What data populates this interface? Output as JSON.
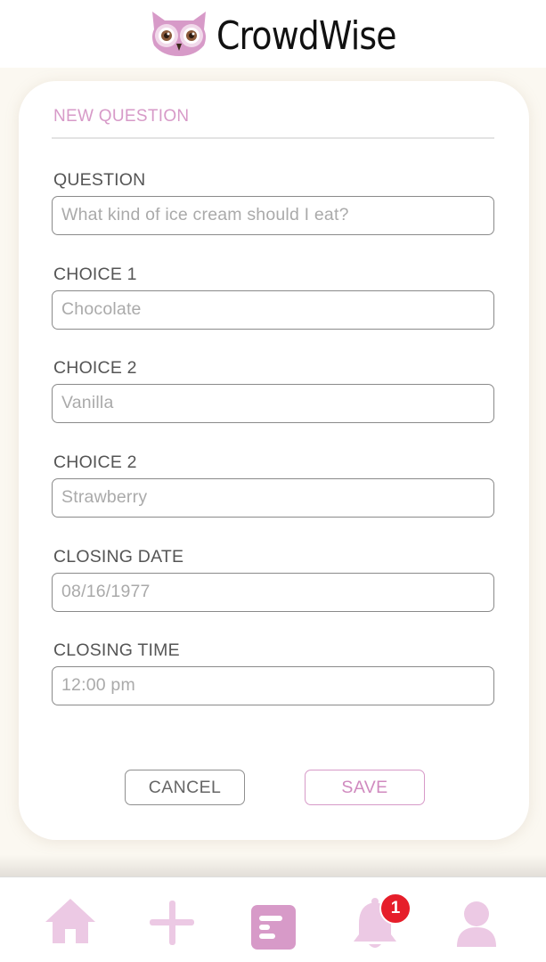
{
  "app": {
    "name": "CrowdWise"
  },
  "form": {
    "title": "NEW QUESTION",
    "fields": [
      {
        "label": "QUESTION",
        "placeholder": "What kind of ice cream should I eat?"
      },
      {
        "label": "CHOICE 1",
        "placeholder": "Chocolate"
      },
      {
        "label": "CHOICE 2",
        "placeholder": "Vanilla"
      },
      {
        "label": "CHOICE 2",
        "placeholder": "Strawberry"
      },
      {
        "label": "CLOSING DATE",
        "placeholder": "08/16/1977"
      },
      {
        "label": "CLOSING TIME",
        "placeholder": "12:00 pm"
      }
    ],
    "cancel_label": "CANCEL",
    "save_label": "SAVE"
  },
  "nav": {
    "items": [
      {
        "icon": "home-icon",
        "active": false
      },
      {
        "icon": "plus-icon",
        "active": false
      },
      {
        "icon": "questions-icon",
        "active": true
      },
      {
        "icon": "bell-icon",
        "active": false
      },
      {
        "icon": "user-icon",
        "active": false
      }
    ],
    "notification_count": "1"
  },
  "colors": {
    "accent": "#d79ac8",
    "accent_light": "#ecc9e4",
    "badge": "#e61e2a",
    "background": "#fbf8f1"
  }
}
